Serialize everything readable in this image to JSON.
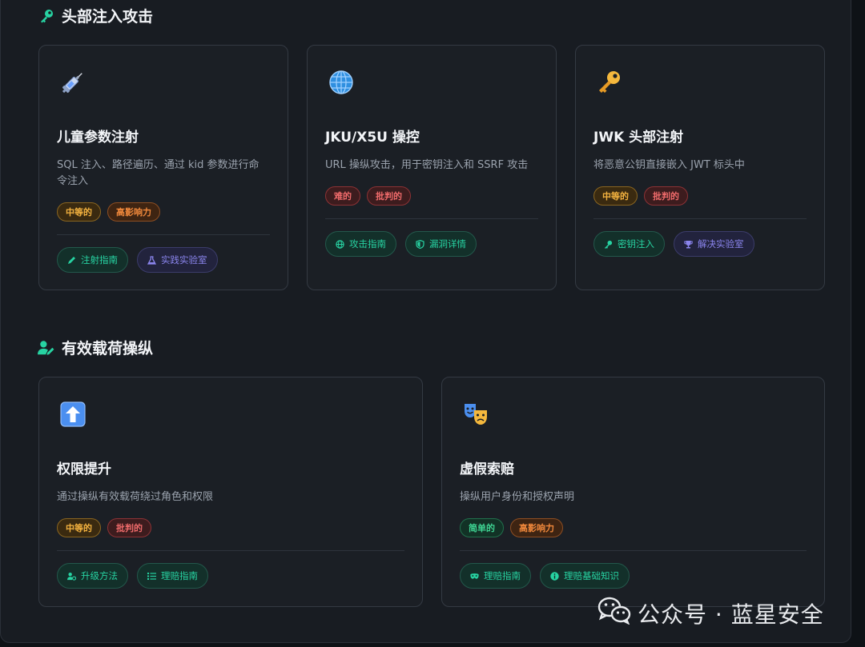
{
  "sections": [
    {
      "title": "头部注入攻击",
      "icon": "key-icon",
      "cards": [
        {
          "emoji": "syringe-icon",
          "title": "儿童参数注射",
          "desc_lines": [
            "SQL 注入、路径遍历、通过 kid 参数进行命",
            "令注入"
          ],
          "tags": [
            {
              "label": "中等的",
              "kind": "medium"
            },
            {
              "label": "高影响力",
              "kind": "high"
            }
          ],
          "actions": [
            {
              "label": "注射指南",
              "icon": "pen-icon",
              "style": "green"
            },
            {
              "label": "实践实验室",
              "icon": "flask-icon",
              "style": "purple"
            }
          ]
        },
        {
          "emoji": "globe-icon",
          "title": "JKU/X5U 操控",
          "desc_lines": [
            "URL 操纵攻击，用于密钥注入和 SSRF 攻击"
          ],
          "tags": [
            {
              "label": "难的",
              "kind": "hard"
            },
            {
              "label": "批判的",
              "kind": "critical"
            }
          ],
          "actions": [
            {
              "label": "攻击指南",
              "icon": "globe-small-icon",
              "style": "green"
            },
            {
              "label": "漏洞详情",
              "icon": "shield-icon",
              "style": "green"
            }
          ]
        },
        {
          "emoji": "key-emoji-icon",
          "title": "JWK 头部注射",
          "desc_lines": [
            "将恶意公钥直接嵌入 JWT 标头中"
          ],
          "tags": [
            {
              "label": "中等的",
              "kind": "medium"
            },
            {
              "label": "批判的",
              "kind": "critical"
            }
          ],
          "actions": [
            {
              "label": "密钥注入",
              "icon": "key-small-icon",
              "style": "green"
            },
            {
              "label": "解决实验室",
              "icon": "trophy-icon",
              "style": "purple"
            }
          ]
        }
      ]
    },
    {
      "title": "有效载荷操纵",
      "icon": "user-edit-icon",
      "cards": [
        {
          "emoji": "up-arrow-icon",
          "title": "权限提升",
          "desc_lines": [
            "通过操纵有效载荷绕过角色和权限"
          ],
          "tags": [
            {
              "label": "中等的",
              "kind": "medium"
            },
            {
              "label": "批判的",
              "kind": "critical"
            }
          ],
          "actions": [
            {
              "label": "升级方法",
              "icon": "user-cog-icon",
              "style": "green"
            },
            {
              "label": "理赔指南",
              "icon": "list-icon",
              "style": "green"
            }
          ]
        },
        {
          "emoji": "theater-masks-icon",
          "title": "虚假索赔",
          "desc_lines": [
            "操纵用户身份和授权声明"
          ],
          "tags": [
            {
              "label": "简单的",
              "kind": "easy"
            },
            {
              "label": "高影响力",
              "kind": "high"
            }
          ],
          "actions": [
            {
              "label": "理赔指南",
              "icon": "mask-icon",
              "style": "green"
            },
            {
              "label": "理赔基础知识",
              "icon": "info-icon",
              "style": "green"
            }
          ]
        }
      ]
    }
  ],
  "watermark": {
    "text": "公众号 · 蓝星安全",
    "icon": "wechat-icon"
  },
  "colors": {
    "accent_green": "#27d3a2",
    "accent_purple": "#8b85ee",
    "panel": "#181c22",
    "card": "#1b1f25"
  }
}
